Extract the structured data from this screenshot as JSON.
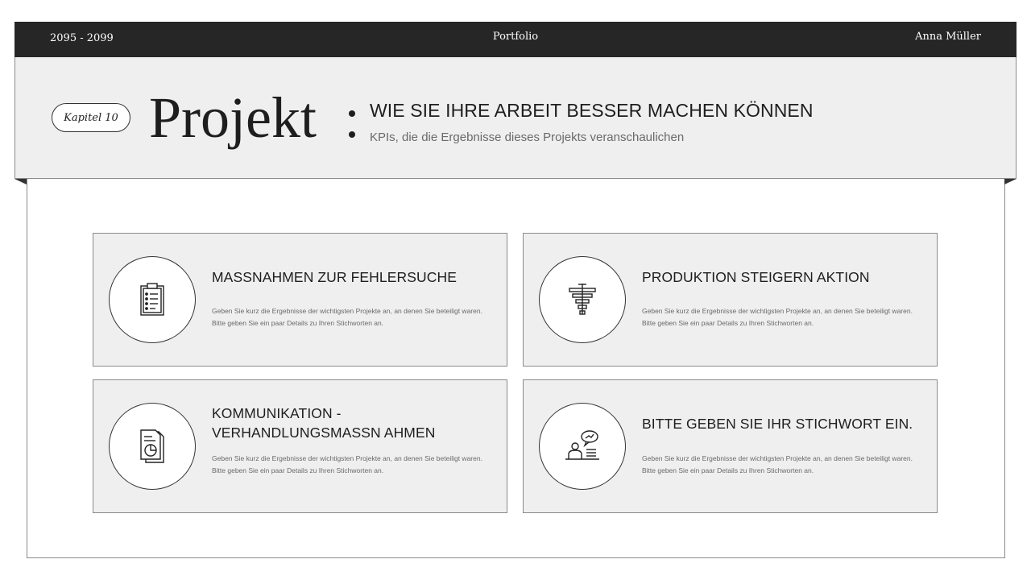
{
  "topbar": {
    "years": "2095 - 2099",
    "title": "Portfolio",
    "author": "Anna Müller"
  },
  "header": {
    "chapter": "Kapitel 10",
    "title": "Projekt",
    "heading": "WIE SIE IHRE ARBEIT BESSER MACHEN KÖNNEN",
    "subtitle": "KPIs, die die Ergebnisse dieses Projekts veranschaulichen"
  },
  "cards": [
    {
      "title": "MASSNAHMEN ZUR FEHLERSUCHE",
      "line1": "Geben Sie kurz die Ergebnisse der wichtigsten Projekte an, an denen Sie beteiligt waren.",
      "line2": "Bitte geben Sie ein paar Details zu Ihren Stichworten an.",
      "icon": "clipboard-checklist-icon"
    },
    {
      "title": "PRODUKTION STEIGERN AKTION",
      "line1": "Geben Sie kurz die Ergebnisse der wichtigsten Projekte an, an denen Sie beteiligt waren.",
      "line2": "Bitte geben Sie ein paar Details zu Ihren Stichworten an.",
      "icon": "funnel-bars-icon"
    },
    {
      "title": "KOMMUNIKATION - VERHANDLUNGSMASSN AHMEN",
      "line1": "Geben Sie kurz die Ergebnisse der wichtigsten Projekte an, an denen Sie beteiligt waren.",
      "line2": "Bitte geben Sie ein paar Details zu Ihren Stichworten an.",
      "icon": "report-pie-document-icon"
    },
    {
      "title": "BITTE GEBEN SIE IHR STICHWORT EIN.",
      "line1": "Geben Sie kurz die Ergebnisse der wichtigsten Projekte an, an denen Sie beteiligt waren.",
      "line2": "Bitte geben Sie ein paar Details zu Ihren Stichworten an.",
      "icon": "presenter-speech-icon"
    }
  ],
  "colors": {
    "dark": "#262626",
    "panel": "#efefef",
    "border": "#8a8a8a",
    "muted": "#6a6a6a"
  }
}
